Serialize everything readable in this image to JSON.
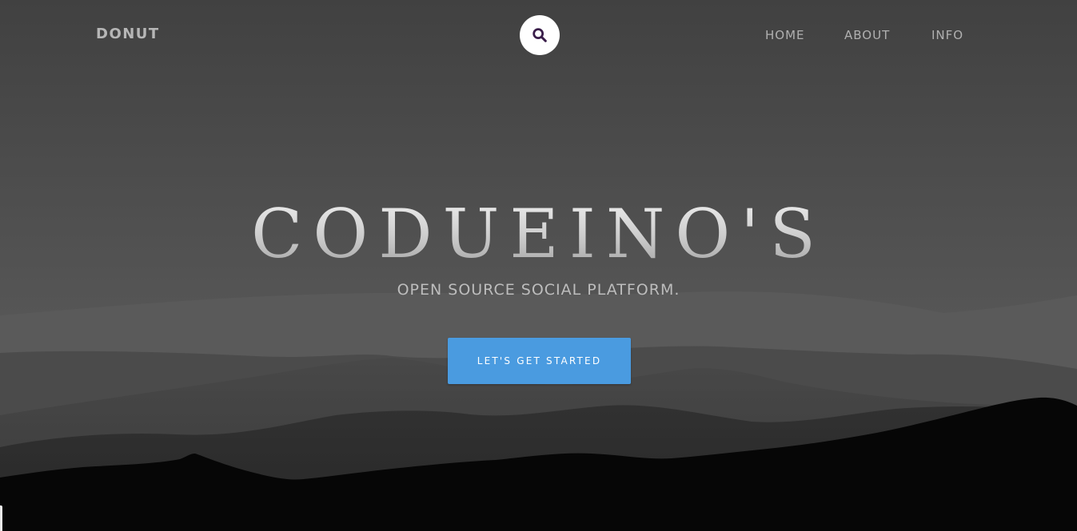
{
  "header": {
    "brand": "DONUT",
    "search_icon": "search-icon",
    "nav": [
      {
        "label": "HOME"
      },
      {
        "label": "ABOUT"
      },
      {
        "label": "INFO"
      }
    ]
  },
  "hero": {
    "title": "CODUEINO'S",
    "subtitle": "OPEN SOURCE SOCIAL PLATFORM.",
    "cta_label": "LET'S GET STARTED"
  },
  "colors": {
    "accent": "#4a9be0",
    "search_icon": "#3a1e4a",
    "background": "#4a4a4a",
    "foreground_hills": "#050505"
  }
}
